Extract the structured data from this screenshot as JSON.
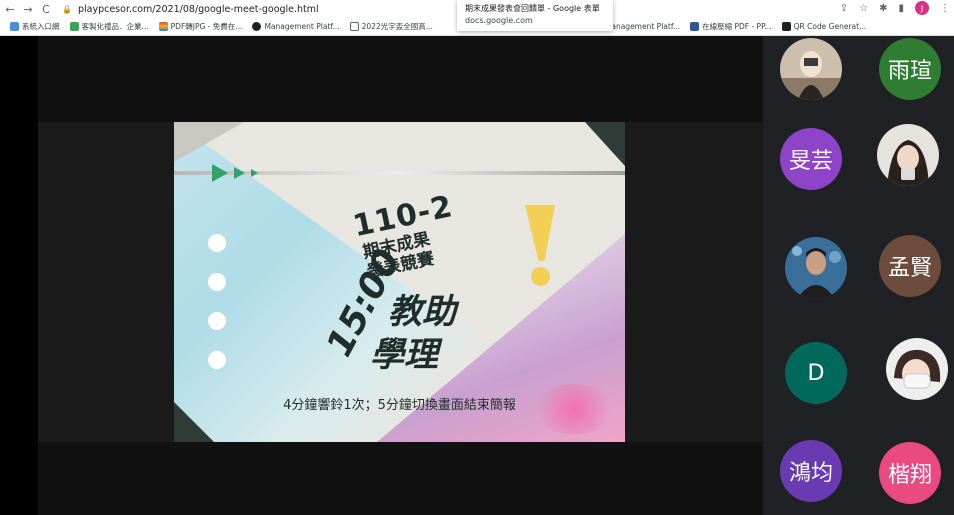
{
  "browser": {
    "url": "playpcesor.com/2021/08/google-meet-google.html",
    "tooltip_title": "期末成果發表會回饋單 - Google 表單",
    "tooltip_sub": "docs.google.com",
    "profile_initial": "J",
    "bookmarks": [
      {
        "label": "系統入口網",
        "color": "#4a90d9"
      },
      {
        "label": "客製化禮品．企業...",
        "color": "#3aa655"
      },
      {
        "label": "PDF轉JPG - 免費在...",
        "color": "#e8453c"
      },
      {
        "label": "Management Platf...",
        "color": "#202124"
      },
      {
        "label": "2022光宇盃全國高...",
        "color": "#ffffff"
      },
      {
        "label": "Management Platf...",
        "color": "#202124"
      },
      {
        "label": "在線壓縮 PDF - PP...",
        "color": "#2b579a"
      },
      {
        "label": "QR Code Generat...",
        "color": "#202124"
      }
    ]
  },
  "slide": {
    "title_number": "110-2",
    "title_line1": "期末成果",
    "title_line2": "發表競賽",
    "time": "15:00",
    "subject_line1": "教助",
    "subject_line2": "學理",
    "footer": "4分鐘響鈴1次；5分鐘切換畫面結束簡報"
  },
  "participants": [
    {
      "label": "雨瑄",
      "color": "#2e7d32"
    },
    {
      "label": "旻芸",
      "color": "#8e44c9"
    },
    {
      "label": "孟賢",
      "color": "#6d4c3d"
    },
    {
      "label": "D",
      "color": "#00695c"
    },
    {
      "label": "鴻均",
      "color": "#6a3ab2"
    },
    {
      "label": "楷翔",
      "color": "#e94a7f"
    }
  ]
}
